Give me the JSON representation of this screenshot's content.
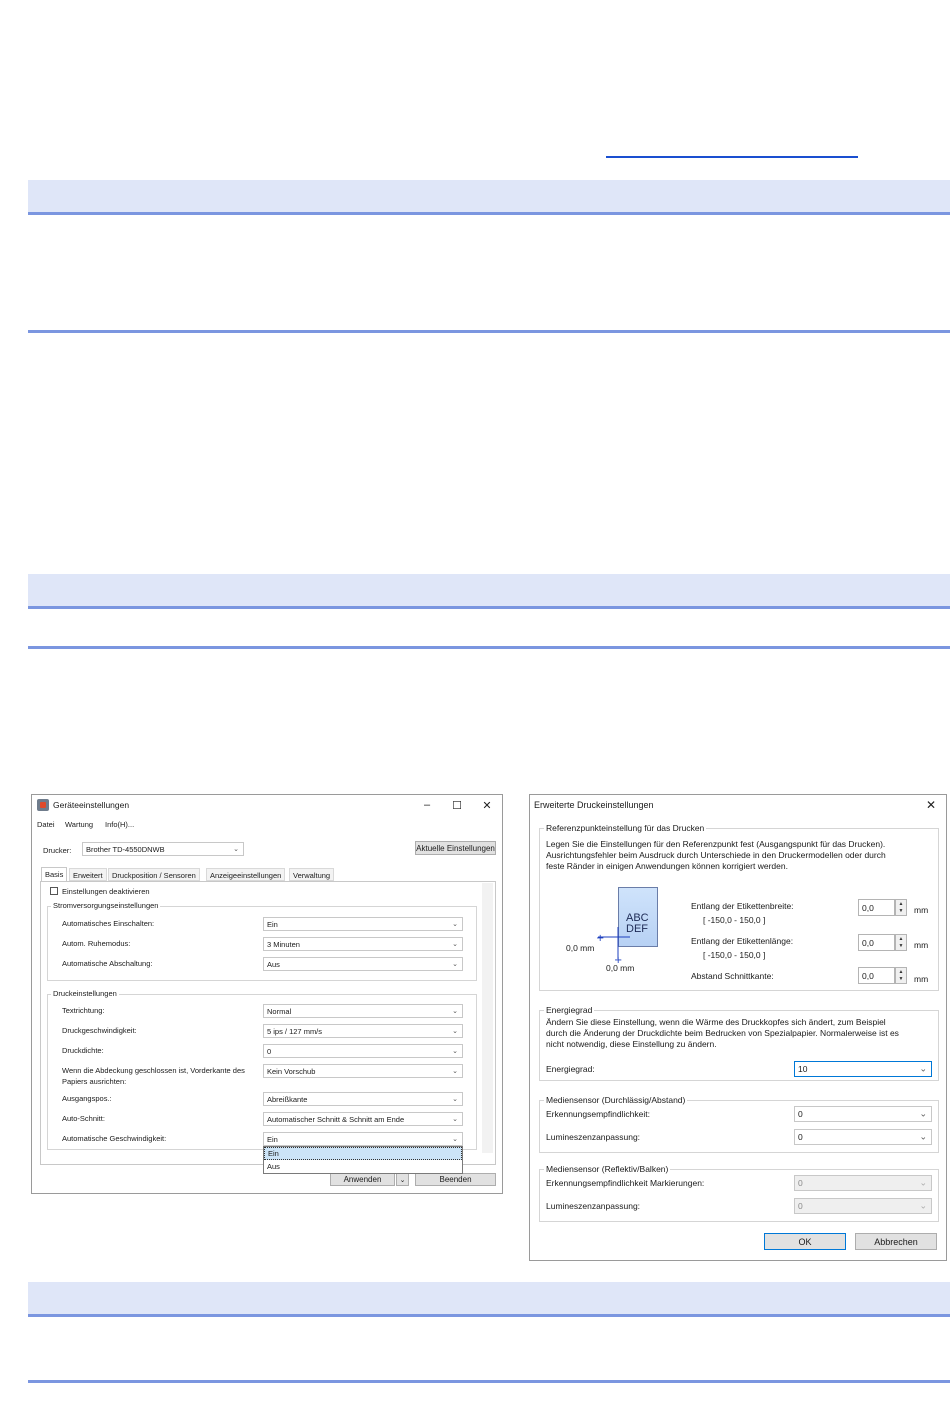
{
  "left_window": {
    "title": "Geräteeinstellungen",
    "menu": [
      "Datei",
      "Wartung",
      "Info(H)..."
    ],
    "printer_label": "Drucker:",
    "printer_value": "Brother TD-4550DNWB",
    "current_settings_button": "Aktuelle Einstellungen",
    "tabs": [
      "Basis",
      "Erweitert",
      "Druckposition / Sensoren",
      "Anzeigeeinstellungen",
      "Verwaltung"
    ],
    "disable_checkbox_label": "Einstellungen deaktivieren",
    "power_group": {
      "title": "Stromversorgungseinstellungen",
      "rows": [
        {
          "label": "Automatisches Einschalten:",
          "value": "Ein"
        },
        {
          "label": "Autom. Ruhemodus:",
          "value": "3 Minuten"
        },
        {
          "label": "Automatische Abschaltung:",
          "value": "Aus"
        }
      ]
    },
    "print_group": {
      "title": "Druckeinstellungen",
      "rows": [
        {
          "label": "Textrichtung:",
          "value": "Normal"
        },
        {
          "label": "Druckgeschwindigkeit:",
          "value": "5 ips / 127 mm/s"
        },
        {
          "label": "Druckdichte:",
          "value": "0"
        },
        {
          "label": "Wenn die Abdeckung geschlossen ist, Vorderkante des",
          "label2": "Papiers ausrichten:",
          "value": "Kein Vorschub"
        },
        {
          "label": "Ausgangspos.:",
          "value": "Abreißkante"
        },
        {
          "label": "Auto-Schnitt:",
          "value": "Automatischer Schnitt & Schnitt am Ende"
        },
        {
          "label": "Automatische Geschwindigkeit:",
          "value": "Ein"
        }
      ]
    },
    "dropdown_options": [
      "Ein",
      "Aus"
    ],
    "apply_button": "Anwenden",
    "close_button": "Beenden"
  },
  "right_dialog": {
    "title": "Erweiterte Druckeinstellungen",
    "ref_group": {
      "title": "Referenzpunkteinstellung für das Drucken",
      "description": [
        "Legen Sie die Einstellungen für den Referenzpunkt fest (Ausgangspunkt für das Drucken).",
        "Ausrichtungsfehler beim Ausdruck durch Unterschiede in den Druckermodellen oder durch",
        "feste Ränder in einigen Anwendungen können korrigiert werden."
      ],
      "illustration_text": [
        "ABC",
        "DEF"
      ],
      "illus_left_label": "0,0 mm",
      "illus_bottom_label": "0,0 mm",
      "width_label": "Entlang der Etikettenbreite:",
      "width_range": "[ -150,0 - 150,0 ]",
      "width_value": "0,0",
      "length_label": "Entlang der Etikettenlänge:",
      "length_range": "[ -150,0 - 150,0 ]",
      "length_value": "0,0",
      "cut_label": "Abstand Schnittkante:",
      "cut_value": "0,0",
      "unit": "mm"
    },
    "energy_group": {
      "title": "Energiegrad",
      "description": [
        "Ändern Sie diese Einstellung, wenn die Wärme des Druckkopfes sich ändert, zum Beispiel",
        "durch die Änderung der Druckdichte beim Bedrucken von Spezialpapier. Normalerweise ist es",
        "nicht notwendig, diese Einstellung zu ändern."
      ],
      "label": "Energiegrad:",
      "value": "10"
    },
    "media_trans_group": {
      "title": "Mediensensor (Durchlässig/Abstand)",
      "sensitivity_label": "Erkennungsempfindlichkeit:",
      "sensitivity_value": "0",
      "luminescence_label": "Lumineszenzanpassung:",
      "luminescence_value": "0"
    },
    "media_refl_group": {
      "title": "Mediensensor (Reflektiv/Balken)",
      "sensitivity_label": "Erkennungsempfindlichkeit Markierungen:",
      "sensitivity_value": "0",
      "luminescence_label": "Lumineszenzanpassung:",
      "luminescence_value": "0"
    },
    "ok_button": "OK",
    "cancel_button": "Abbrechen"
  },
  "colors": {
    "band": "#dfe6f8",
    "rule": "#7b96e0",
    "link": "#1a4fd0",
    "accent": "#0078d7"
  }
}
